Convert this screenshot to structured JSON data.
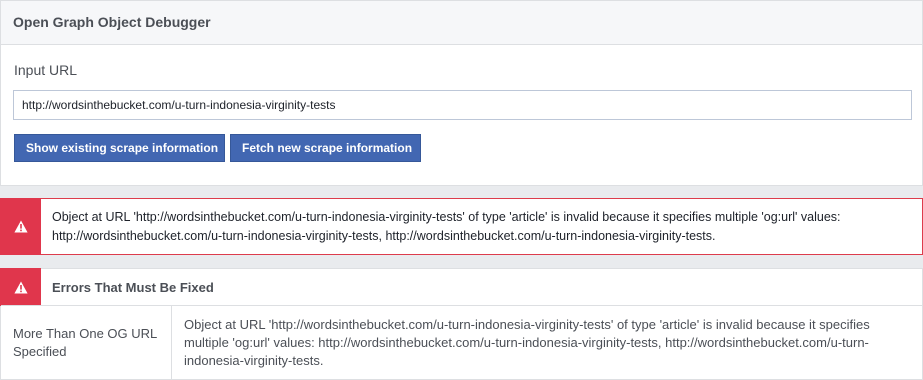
{
  "header": {
    "title": "Open Graph Object Debugger"
  },
  "form": {
    "input_label": "Input URL",
    "url_value": "http://wordsinthebucket.com/u-turn-indonesia-virginity-tests",
    "show_button": "Show existing scrape information",
    "fetch_button": "Fetch new scrape information"
  },
  "warning": {
    "icon": "warning-triangle-icon",
    "message": "Object at URL 'http://wordsinthebucket.com/u-turn-indonesia-virginity-tests' of type 'article' is invalid because it specifies multiple 'og:url' values: http://wordsinthebucket.com/u-turn-indonesia-virginity-tests, http://wordsinthebucket.com/u-turn-indonesia-virginity-tests."
  },
  "errors": {
    "title": "Errors That Must Be Fixed",
    "icon": "warning-triangle-icon",
    "rows": [
      {
        "name": "More Than One OG URL Specified",
        "description": "Object at URL 'http://wordsinthebucket.com/u-turn-indonesia-virginity-tests' of type 'article' is invalid because it specifies multiple 'og:url' values: http://wordsinthebucket.com/u-turn-indonesia-virginity-tests, http://wordsinthebucket.com/u-turn-indonesia-virginity-tests."
      }
    ]
  },
  "colors": {
    "primary_button": "#4267b2",
    "alert_red": "#e0364c",
    "page_background": "#e9ebee"
  }
}
